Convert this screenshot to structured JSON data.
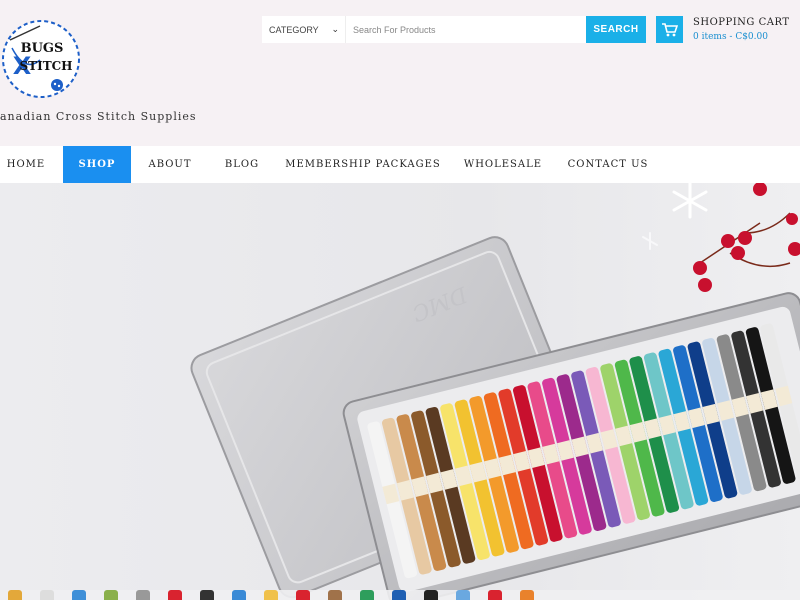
{
  "site": {
    "logo_line1": "BUGS",
    "logo_line2": "X",
    "logo_line3": "STITCH",
    "tagline": "anadian Cross Stitch Supplies"
  },
  "search": {
    "category_label": "CATEGORY",
    "placeholder": "Search For Products",
    "button_label": "SEARCH"
  },
  "cart": {
    "title": "SHOPPING CART",
    "summary": "0 items - C$0.00"
  },
  "nav": {
    "items": [
      {
        "label": "HOME"
      },
      {
        "label": "SHOP"
      },
      {
        "label": "ABOUT"
      },
      {
        "label": "BLOG"
      },
      {
        "label": "MEMBERSHIP PACKAGES"
      },
      {
        "label": "WHOLESALE"
      },
      {
        "label": "CONTACT US"
      }
    ],
    "active": "SHOP"
  },
  "hero": {
    "tin_lid_text": "DMC"
  },
  "colors": {
    "accent": "#1ab0e8",
    "nav_active": "#1a8ff0",
    "logo_blue": "#1d5fc8",
    "header_bg": "#f6f1f4"
  },
  "icons": {
    "cart": "shopping-cart-icon",
    "dropdown": "chevron-down-icon"
  }
}
